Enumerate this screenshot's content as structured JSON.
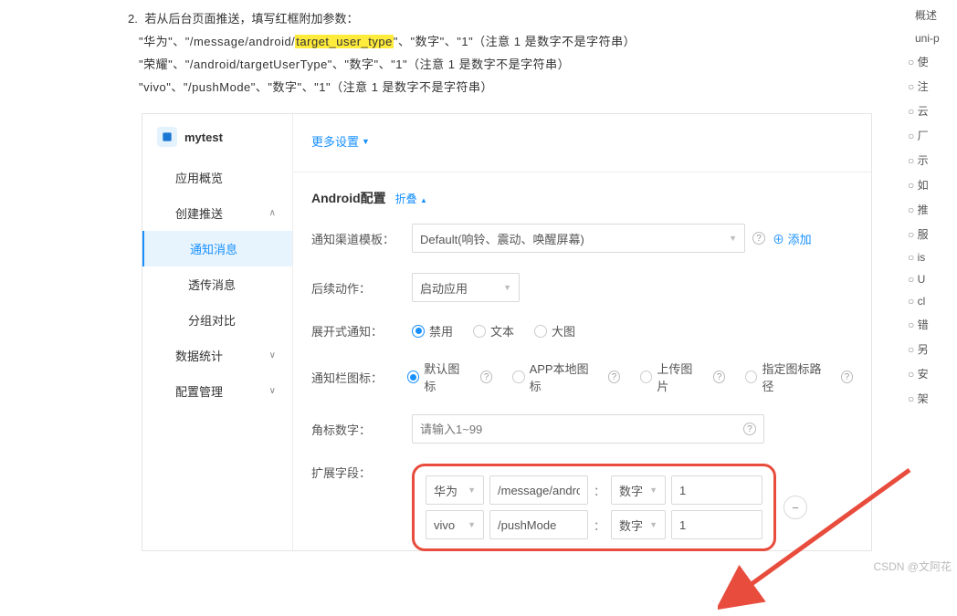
{
  "article": {
    "item_num": "2.",
    "item_text": "若从后台页面推送，填写红框附加参数：",
    "line1_pre": "\"华为\"、\"/message/android/",
    "line1_hl": "target_user_type",
    "line1_post": "\"、\"数字\"、\"1\"（注意 1 是数字不是字符串）",
    "line2": "\"荣耀\"、\"/android/targetUserType\"、\"数字\"、\"1\"（注意 1 是数字不是字符串）",
    "line3": "\"vivo\"、\"/pushMode\"、\"数字\"、\"1\"（注意 1 是数字不是字符串）"
  },
  "brand": "mytest",
  "nav": {
    "overview": "应用概览",
    "create": "创建推送",
    "notify": "通知消息",
    "transparent": "透传消息",
    "abtest": "分组对比",
    "stats": "数据统计",
    "config": "配置管理"
  },
  "top": {
    "more": "更多设置"
  },
  "section": {
    "title": "Android配置",
    "collapse": "折叠"
  },
  "form": {
    "channel_lbl": "通知渠道模板：",
    "channel_val": "Default(响铃、震动、唤醒屏幕)",
    "add": "添加",
    "action_lbl": "后续动作：",
    "action_val": "启动应用",
    "expand_lbl": "展开式通知：",
    "r_disable": "禁用",
    "r_text": "文本",
    "r_big": "大图",
    "icon_lbl": "通知栏图标：",
    "r_default_icon": "默认图标",
    "r_local_icon": "APP本地图标",
    "r_upload": "上传图片",
    "r_path": "指定图标路径",
    "badge_lbl": "角标数字：",
    "badge_ph": "请输入1~99",
    "ext_lbl": "扩展字段："
  },
  "ext": {
    "rows": [
      {
        "vendor": "华为",
        "key": "/message/androi",
        "dtype": "数字",
        "value": "1"
      },
      {
        "vendor": "vivo",
        "key": "/pushMode",
        "dtype": "数字",
        "value": "1"
      }
    ]
  },
  "outline": {
    "i0": "概述",
    "i1": "uni-p",
    "s0": "使",
    "s1": "注",
    "s2": "云",
    "s3": "厂",
    "s4": "示",
    "s5": "如",
    "s6": "推",
    "s7": "服",
    "s8": "is",
    "s9": "U",
    "s10": "cl",
    "s11": "错",
    "s12": "另",
    "s13": "安",
    "s14": "架"
  },
  "watermark": "CSDN @文阿花"
}
